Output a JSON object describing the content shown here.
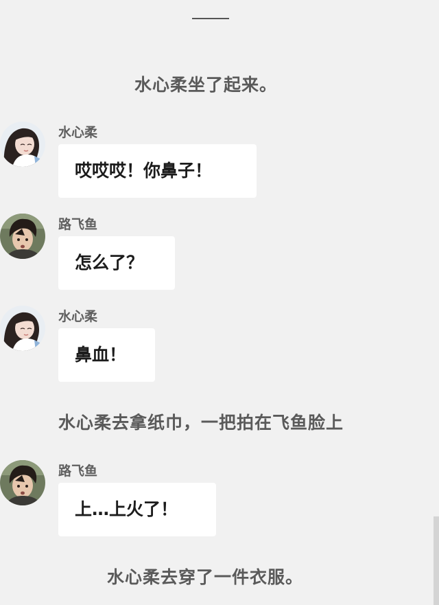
{
  "narration": {
    "n1": "水心柔坐了起来。",
    "n2": "水心柔去拿纸巾，一把拍在飞鱼脸上",
    "n3": "水心柔去穿了一件衣服。"
  },
  "messages": [
    {
      "sender": "水心柔",
      "text": "哎哎哎！你鼻子！",
      "avatar": "female-avatar-icon"
    },
    {
      "sender": "路飞鱼",
      "text": "怎么了？",
      "avatar": "male-avatar-icon"
    },
    {
      "sender": "水心柔",
      "text": "鼻血！",
      "avatar": "female-avatar-icon"
    },
    {
      "sender": "路飞鱼",
      "text": "上…上火了！",
      "avatar": "male-avatar-icon"
    }
  ],
  "colors": {
    "background": "#f1f1f1",
    "bubble": "#ffffff",
    "narration_text": "#5a5a5a",
    "message_text": "#1c1c1c"
  }
}
